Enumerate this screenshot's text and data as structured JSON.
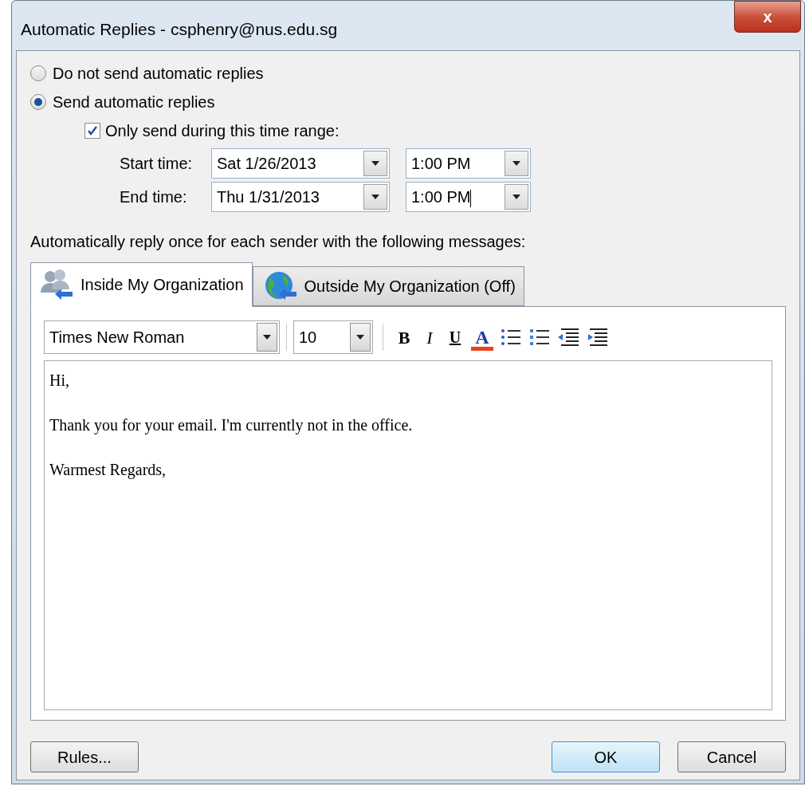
{
  "window": {
    "title": "Automatic Replies - csphenry@nus.edu.sg",
    "close": "x"
  },
  "reply_mode": [
    {
      "label": "Do not send automatic replies",
      "selected": false
    },
    {
      "label": "Send automatic replies",
      "selected": true
    }
  ],
  "time_range": {
    "label": "Only send during this time range:",
    "checked": true,
    "rows": [
      {
        "label": "Start time:",
        "date": "Sat 1/26/2013",
        "time": "1:00 PM"
      },
      {
        "label": "End time:",
        "date": "Thu 1/31/2013",
        "time": "1:00 PM"
      }
    ]
  },
  "instruction": "Automatically reply once for each sender with the following messages:",
  "tabs": [
    {
      "label": "Inside My Organization",
      "selected": true,
      "kind": "people"
    },
    {
      "label": "Outside My Organization (Off)",
      "selected": false,
      "kind": "globe"
    }
  ],
  "toolbar": {
    "font": "Times New Roman",
    "size": "10",
    "buttons": [
      {
        "kind": "bold",
        "label": "B"
      },
      {
        "kind": "italic",
        "label": "I"
      },
      {
        "kind": "underline",
        "label": "U"
      },
      {
        "kind": "color",
        "label": "A",
        "color": "#e8401c"
      },
      {
        "kind": "bullets"
      },
      {
        "kind": "numbering"
      },
      {
        "kind": "outdent"
      },
      {
        "kind": "indent"
      }
    ]
  },
  "message": [
    "Hi,",
    "Thank you for your email. I'm currently not in the office.",
    "Warmest Regards,"
  ],
  "buttons": [
    {
      "label": "Rules...",
      "kind": "rules"
    },
    {
      "label": "OK",
      "kind": "ok",
      "default": true
    },
    {
      "label": "Cancel",
      "kind": "cancel",
      "default": false
    }
  ]
}
